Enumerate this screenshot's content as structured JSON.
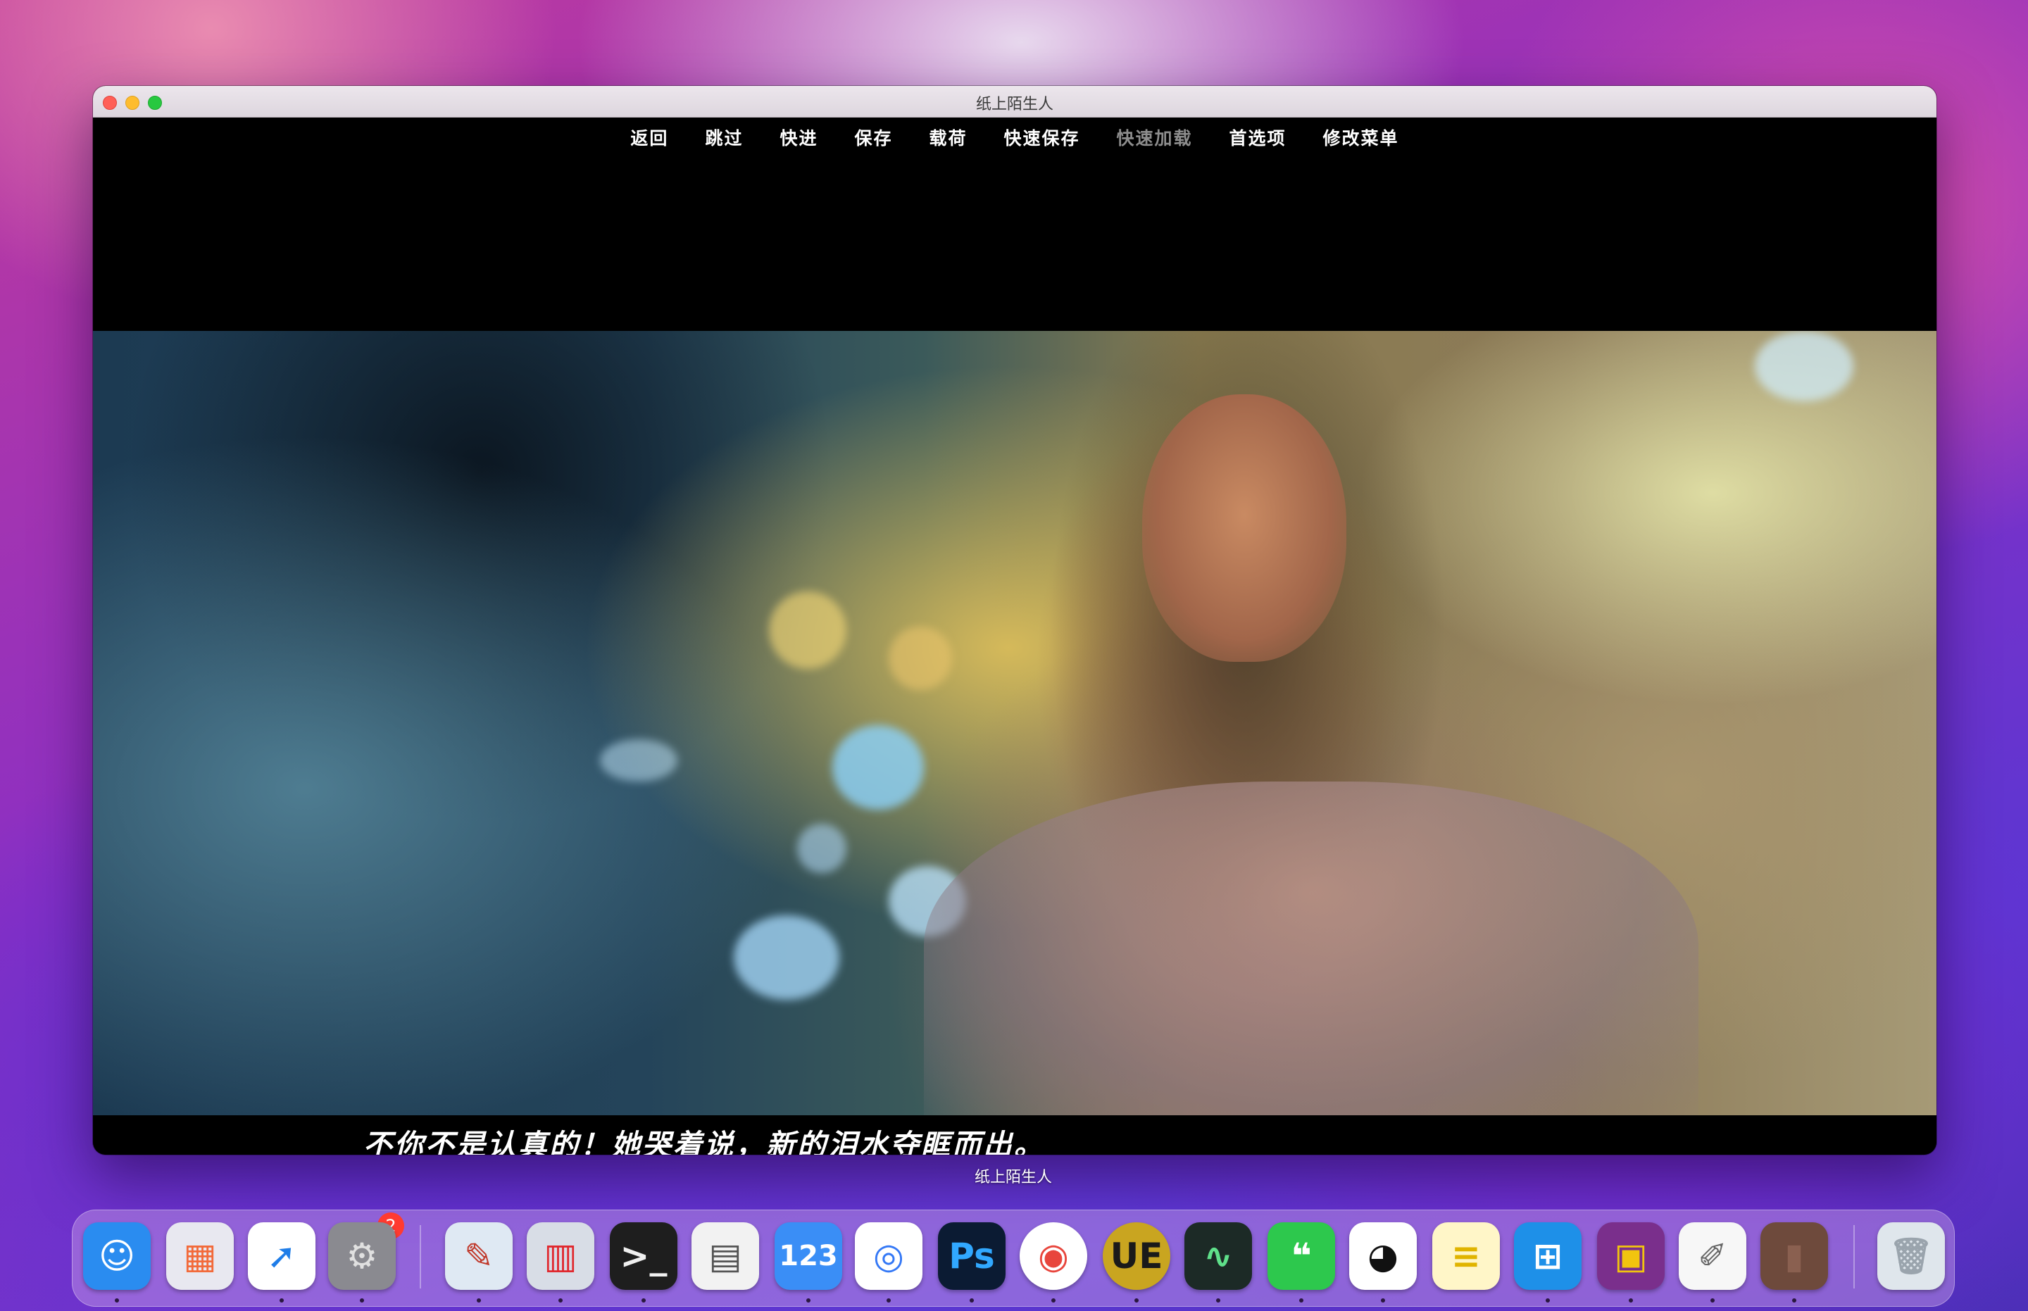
{
  "window": {
    "title": "纸上陌生人"
  },
  "menu": {
    "items": [
      {
        "label": "返回",
        "enabled": true
      },
      {
        "label": "跳过",
        "enabled": true
      },
      {
        "label": "快进",
        "enabled": true
      },
      {
        "label": "保存",
        "enabled": true
      },
      {
        "label": "载荷",
        "enabled": true
      },
      {
        "label": "快速保存",
        "enabled": true
      },
      {
        "label": "快速加载",
        "enabled": false
      },
      {
        "label": "首选项",
        "enabled": true
      },
      {
        "label": "修改菜单",
        "enabled": true
      }
    ]
  },
  "dialogue": {
    "text": "不你不是认真的！她哭着说，新的泪水夺眶而出。"
  },
  "dock_label": "纸上陌生人",
  "dock": {
    "items": [
      {
        "name": "finder-icon",
        "glyph": "☺",
        "bg": "#2a8cf0",
        "fg": "#ffffff"
      },
      {
        "name": "launchpad-icon",
        "glyph": "▦",
        "bg": "#e8e8f0",
        "fg": "#f26a3a"
      },
      {
        "name": "safari-icon",
        "glyph": "➚",
        "bg": "#ffffff",
        "fg": "#1f7de8"
      },
      {
        "name": "system-preferences-icon",
        "glyph": "⚙",
        "bg": "#8a8a90",
        "fg": "#e0e0e0",
        "badge": "2"
      },
      {
        "name": "preview-icon",
        "glyph": "✎",
        "bg": "#dfe9f3",
        "fg": "#c0392b"
      },
      {
        "name": "parallels-icon",
        "glyph": "▥",
        "bg": "#d8dde6",
        "fg": "#e0282e"
      },
      {
        "name": "terminal-icon",
        "glyph": ">_",
        "bg": "#1e1e1e",
        "fg": "#f0f0f0"
      },
      {
        "name": "printer-icon",
        "glyph": "▤",
        "bg": "#f2f2f2",
        "fg": "#555555"
      },
      {
        "name": "numbers-icon",
        "glyph": "123",
        "bg": "#3a8ef6",
        "fg": "#ffffff"
      },
      {
        "name": "baidu-netdisk-icon",
        "glyph": "◎",
        "bg": "#ffffff",
        "fg": "#3478f6"
      },
      {
        "name": "photoshop-icon",
        "glyph": "Ps",
        "bg": "#0b1b33",
        "fg": "#31a8ff"
      },
      {
        "name": "chrome-icon",
        "glyph": "◉",
        "bg": "#ffffff",
        "fg": "#e8453c"
      },
      {
        "name": "ultraedit-icon",
        "glyph": "UE",
        "bg": "#c9a520",
        "fg": "#1a1a1a"
      },
      {
        "name": "activity-monitor-icon",
        "glyph": "∿",
        "bg": "#1c2a26",
        "fg": "#5fe08a"
      },
      {
        "name": "wechat-icon",
        "glyph": "❝",
        "bg": "#2dc84d",
        "fg": "#ffffff"
      },
      {
        "name": "qq-icon",
        "glyph": "◕",
        "bg": "#ffffff",
        "fg": "#111111"
      },
      {
        "name": "notes-icon",
        "glyph": "≡",
        "bg": "#fff6c8",
        "fg": "#e0b400"
      },
      {
        "name": "windows-app-icon",
        "glyph": "⊞",
        "bg": "#1e90e8",
        "fg": "#ffffff"
      },
      {
        "name": "winrar-icon",
        "glyph": "▣",
        "bg": "#7a2f8c",
        "fg": "#f1c40f"
      },
      {
        "name": "textedit-icon",
        "glyph": "✐",
        "bg": "#f7f7f7",
        "fg": "#666666"
      },
      {
        "name": "notebook-icon",
        "glyph": "▮",
        "bg": "#6e4a3c",
        "fg": "#8a6050"
      },
      {
        "name": "trash-icon",
        "glyph": "🗑",
        "bg": "#dfe6ec",
        "fg": "#9aa4ad"
      }
    ]
  }
}
